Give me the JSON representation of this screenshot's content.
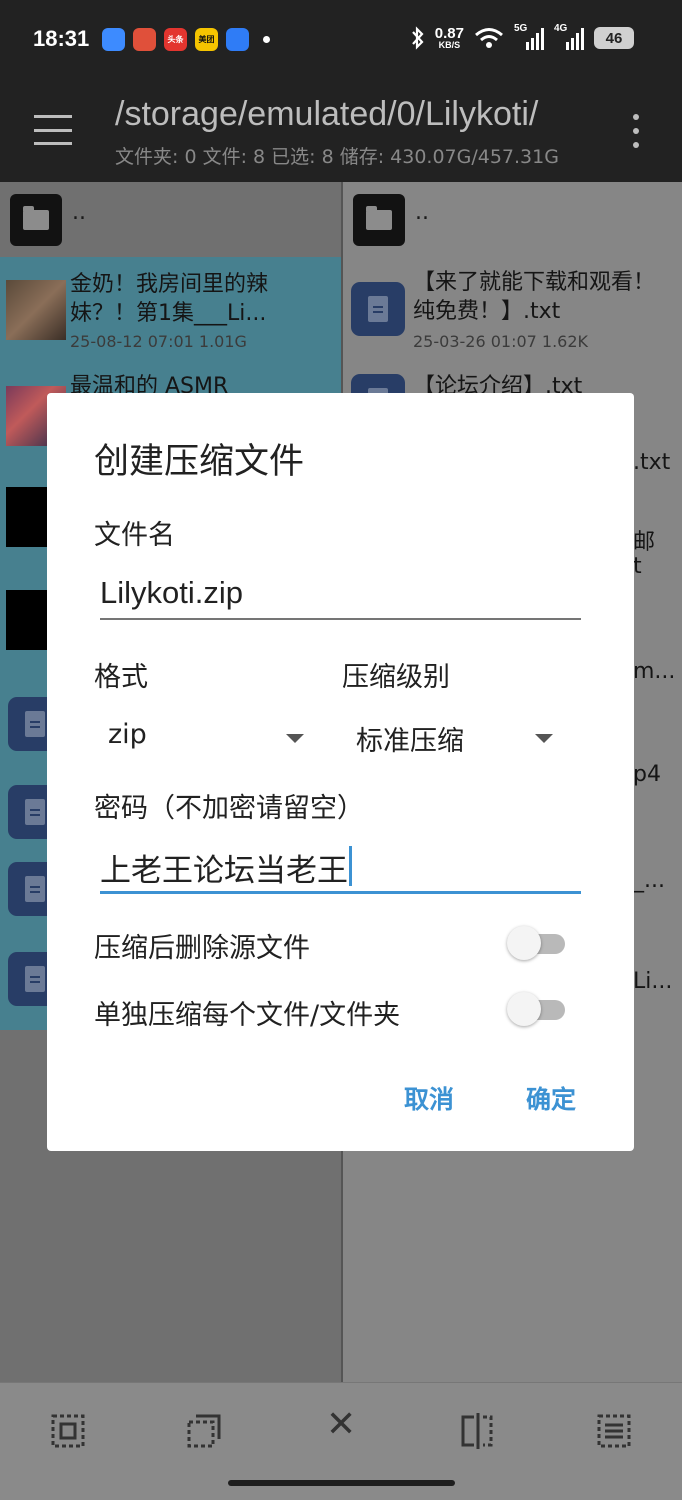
{
  "status_bar": {
    "time": "18:31",
    "app_icons": [
      {
        "name": "app-icon-blue",
        "color": "#3d8bff",
        "text": ""
      },
      {
        "name": "app-icon-red",
        "color": "#e0503a",
        "text": ""
      },
      {
        "name": "app-icon-toutiao",
        "color": "#e3352f",
        "text": "头条"
      },
      {
        "name": "app-icon-meituan",
        "color": "#f5c400",
        "text": "美团"
      },
      {
        "name": "app-icon-browser",
        "color": "#2f7cf6",
        "text": ""
      }
    ],
    "net_speed_value": "0.87",
    "net_speed_unit": "KB/S",
    "signal_1_label": "5G",
    "signal_2_label": "4G",
    "battery": "46"
  },
  "app_bar": {
    "path": "/storage/emulated/0/Lilykoti/",
    "info": "文件夹: 0  文件: 8  已选: 8  储存: 430.07G/457.31G"
  },
  "left_pane": {
    "parent_label": "..",
    "files": [
      {
        "name": "金奶！我房间里的辣妹？！第1集___Li...",
        "meta": "25-08-12 07:01  1.01G"
      },
      {
        "name": "最温和的 ASMR",
        "meta": ""
      }
    ]
  },
  "right_pane": {
    "parent_label": "..",
    "files": [
      {
        "name": "【来了就能下载和观看！纯免费！】.txt",
        "meta": "25-03-26 01:07  1.62K"
      },
      {
        "name": "【论坛介绍】.txt",
        "meta": ""
      }
    ],
    "peek": [
      ".txt",
      "邮",
      "t",
      "m...",
      "p4",
      "_...",
      "Li..."
    ]
  },
  "dialog": {
    "title": "创建压缩文件",
    "filename_label": "文件名",
    "filename_value": "Lilykoti.zip",
    "format_label": "格式",
    "format_value": "zip",
    "level_label": "压缩级别",
    "level_value": "标准压缩",
    "password_label": "密码（不加密请留空）",
    "password_value": "上老王论坛当老王",
    "delete_source_label": "压缩后删除源文件",
    "delete_source_on": false,
    "each_separately_label": "单独压缩每个文件/文件夹",
    "each_separately_on": false,
    "cancel_label": "取消",
    "ok_label": "确定",
    "accent_color": "#3c92d3"
  }
}
